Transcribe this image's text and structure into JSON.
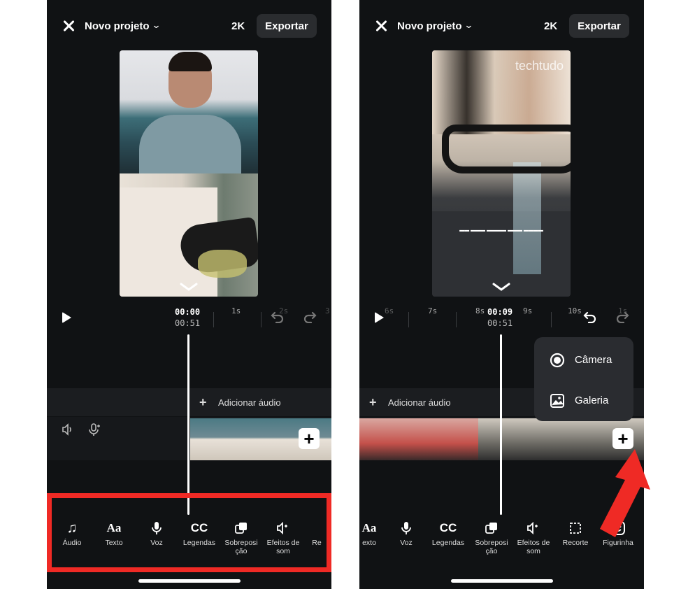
{
  "left_screen": {
    "project_title": "Novo projeto",
    "resolution": "2K",
    "export_label": "Exportar",
    "time_current": "00:00",
    "time_total": "00:51",
    "ruler_ticks": [
      "1s",
      "2s",
      "3"
    ],
    "add_audio_label": "Adicionar áudio",
    "tools": [
      "Áudio",
      "Texto",
      "Voz",
      "Legendas",
      "Sobreposi ção",
      "Efeitos de som",
      "Re"
    ]
  },
  "right_screen": {
    "project_title": "Novo projeto",
    "resolution": "2K",
    "export_label": "Exportar",
    "watermark": "techtudo",
    "time_current": "00:09",
    "time_total": "00:51",
    "ruler_ticks": [
      "6s",
      "7s",
      "8s",
      "9s",
      "10s",
      "1s"
    ],
    "add_audio_label": "Adicionar áudio",
    "popup": {
      "camera": "Câmera",
      "gallery": "Galeria"
    },
    "tools": [
      "exto",
      "Voz",
      "Legendas",
      "Sobreposi ção",
      "Efeitos de som",
      "Recorte",
      "Figurinha"
    ]
  },
  "colors": {
    "highlight": "#ef2a25",
    "background": "#101214",
    "accent": "#ffffff"
  }
}
